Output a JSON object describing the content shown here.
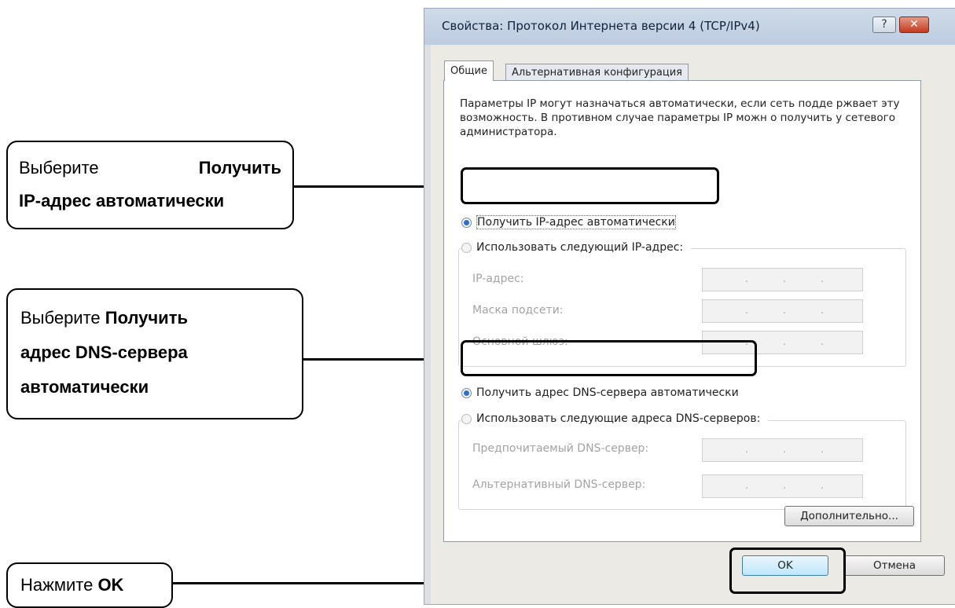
{
  "callouts": {
    "c1": {
      "w1": "Выберите",
      "w2": "Получить",
      "line2": "IP-адрес автоматически"
    },
    "c2": {
      "w1": "Выберите ",
      "w2": "Получить",
      "line2": "адрес DNS-сервера",
      "line3": "автоматически"
    },
    "c3": {
      "w1": "Нажмите ",
      "w2": "OK"
    }
  },
  "dialog": {
    "title": "Свойства: Протокол Интернета версии 4 (TCP/IPv4)",
    "help": "?",
    "close": "✕",
    "tabs": [
      "Общие",
      "Альтернативная конфигурация"
    ],
    "description": "Параметры IP могут назначаться автоматически, если сеть подде ржвает эту возможность. В противном случае параметры IP можн о получить у сетевого администратора.",
    "ip": {
      "auto_label": "Получить IP-адрес автоматически",
      "manual_label": "Использовать следующий IP-адрес:",
      "fields": [
        "IP-адрес:",
        "Маска подсети:",
        "Основной шлюз:"
      ]
    },
    "dns": {
      "auto_label": "Получить адрес DNS-сервера автоматически",
      "manual_label": "Использовать следующие адреса DNS-серверов:",
      "fields": [
        "Предпочитаемый DNS-сервер:",
        "Альтернативный DNS-сервер:"
      ]
    },
    "ip_dots": [
      ".",
      ".",
      "."
    ],
    "advanced": "Дополнительно...",
    "ok": "OK",
    "cancel": "Отмена"
  },
  "colors": {
    "accent": "#2b6fd1",
    "titlebar": "#c6d4e5",
    "close": "#c23b1f"
  }
}
